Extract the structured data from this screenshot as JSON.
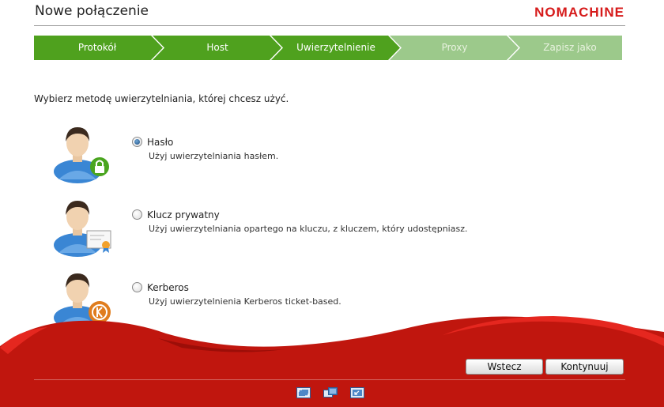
{
  "header": {
    "title": "Nowe połączenie",
    "logo": "NOMACHINE"
  },
  "wizard": {
    "steps": [
      {
        "label": "Protokół",
        "state": "done"
      },
      {
        "label": "Host",
        "state": "done"
      },
      {
        "label": "Uwierzytelnienie",
        "state": "current"
      },
      {
        "label": "Proxy",
        "state": "pending"
      },
      {
        "label": "Zapisz jako",
        "state": "pending"
      }
    ],
    "colors": {
      "done": "#4fa11e",
      "pending": "#9cc98b"
    }
  },
  "prompt": "Wybierz metodę uwierzytelniania, której chcesz użyć.",
  "options": [
    {
      "title": "Hasło",
      "description": "Użyj uwierzytelniania hasłem.",
      "selected": true,
      "icon": "user-lock-icon"
    },
    {
      "title": "Klucz prywatny",
      "description": "Użyj uwierzytelniania opartego na kluczu, z kluczem, który udostępniasz.",
      "selected": false,
      "icon": "user-certificate-icon"
    },
    {
      "title": "Kerberos",
      "description": "Użyj uwierzytelnienia Kerberos ticket-based.",
      "selected": false,
      "icon": "user-kerberos-icon"
    }
  ],
  "buttons": {
    "back": "Wstecz",
    "next": "Kontynuuj"
  },
  "toolbar": {
    "icons": [
      "fullscreen-icon",
      "window-switch-icon",
      "minimize-icon"
    ]
  },
  "colors": {
    "accent_red": "#c0160e",
    "logo_red": "#d61a1a"
  }
}
